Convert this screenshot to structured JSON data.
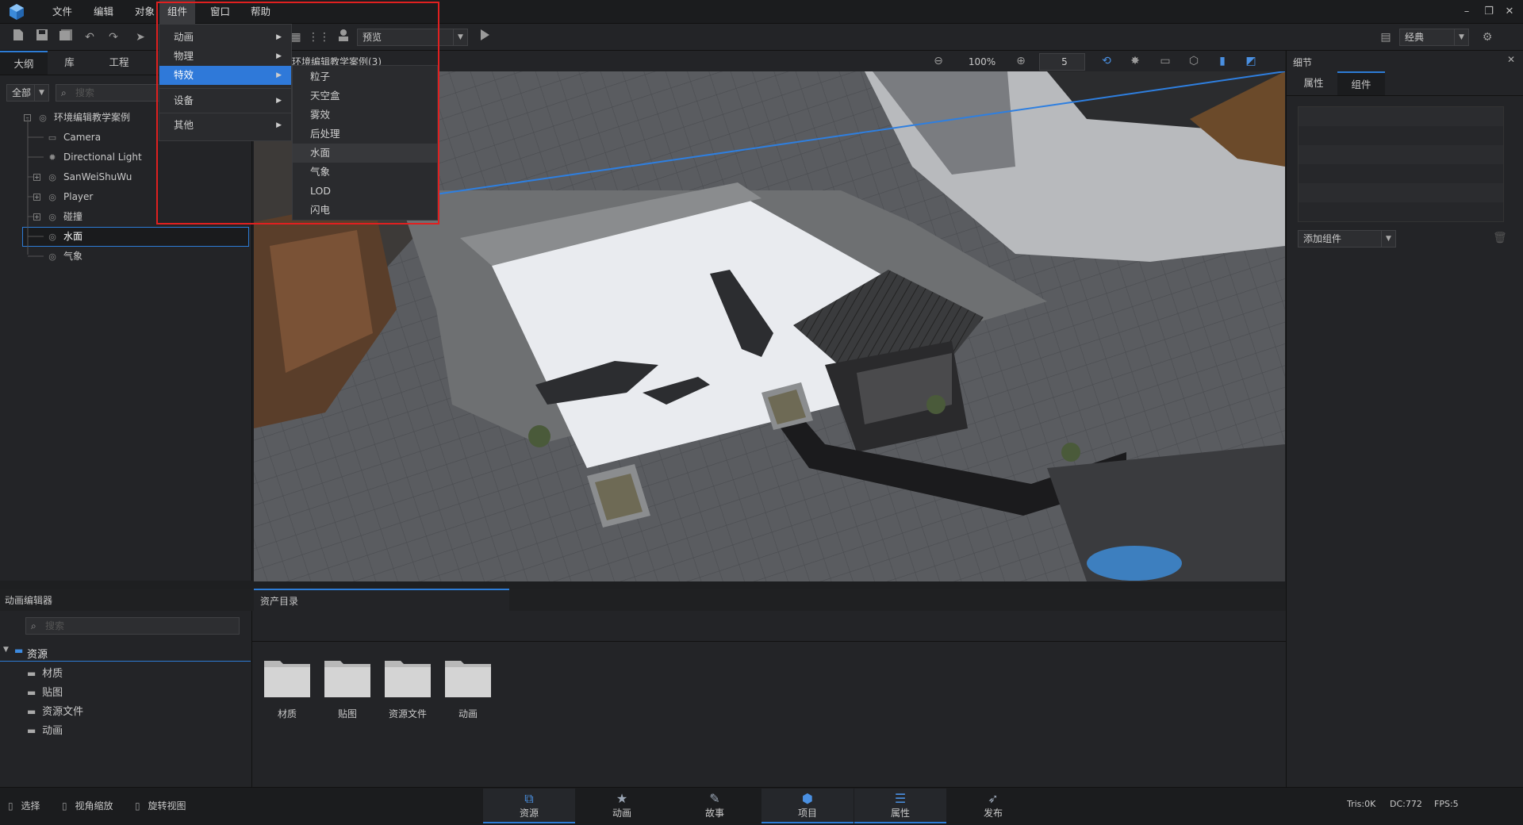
{
  "menubar": {
    "items": [
      "文件",
      "编辑",
      "对象",
      "组件",
      "窗口",
      "帮助"
    ],
    "active": "组件"
  },
  "window_controls": {
    "minimize": "–",
    "restore": "❐",
    "close": "✕"
  },
  "toolbar": {
    "preview_combo": "预览",
    "layout_combo": "经典"
  },
  "left_panel": {
    "tabs": [
      "大纲",
      "库",
      "工程"
    ],
    "filter_value": "全部",
    "search_placeholder": "搜索",
    "tree": [
      {
        "label": "环境编辑教学案例",
        "icon": "scene-icon"
      },
      {
        "label": "Camera",
        "icon": "camera-icon"
      },
      {
        "label": "Directional Light",
        "icon": "light-icon"
      },
      {
        "label": "SanWeiShuWu",
        "icon": "object-icon"
      },
      {
        "label": "Player",
        "icon": "object-icon"
      },
      {
        "label": "碰撞",
        "icon": "object-icon"
      },
      {
        "label": "水面",
        "icon": "object-icon"
      },
      {
        "label": "气象",
        "icon": "object-icon"
      }
    ],
    "selected": "水面"
  },
  "viewport": {
    "tab_title": "环境编辑教学案例(3)",
    "zoom": "100%",
    "grid_value": "5"
  },
  "right_panel": {
    "title": "细节",
    "tabs": [
      "属性",
      "组件"
    ],
    "active_tab": "组件",
    "add_component_label": "添加组件"
  },
  "component_menu": {
    "items": [
      {
        "label": "动画"
      },
      {
        "label": "物理"
      },
      {
        "label": "特效"
      },
      {
        "label": "设备"
      },
      {
        "label": "其他"
      }
    ],
    "active": "特效",
    "effects_submenu": [
      "粒子",
      "天空盒",
      "雾效",
      "后处理",
      "水面",
      "气象",
      "LOD",
      "闪电"
    ],
    "hovered": "水面"
  },
  "anim_editor": {
    "title": "动画编辑器",
    "search_placeholder": "搜索",
    "root": "资源",
    "folders": [
      "材质",
      "贴图",
      "资源文件",
      "动画"
    ]
  },
  "asset_panel": {
    "tab": "资产目录",
    "folders": [
      "材质",
      "贴图",
      "资源文件",
      "动画"
    ]
  },
  "statusbar": {
    "hints": [
      "选择",
      "视角缩放",
      "旋转视图"
    ],
    "nav_tabs": [
      "资源",
      "动画",
      "故事",
      "项目",
      "属性",
      "发布"
    ],
    "active_nav": [
      "资源",
      "项目",
      "属性"
    ],
    "stats": {
      "tris": "Tris:0K",
      "dc": "DC:772",
      "fps": "FPS:5"
    }
  },
  "colors": {
    "accent": "#2d7cd6",
    "menu_highlight": "#2f79d9",
    "annotation_red": "#e02020",
    "background": "#1e1f21",
    "panel": "#232427"
  }
}
